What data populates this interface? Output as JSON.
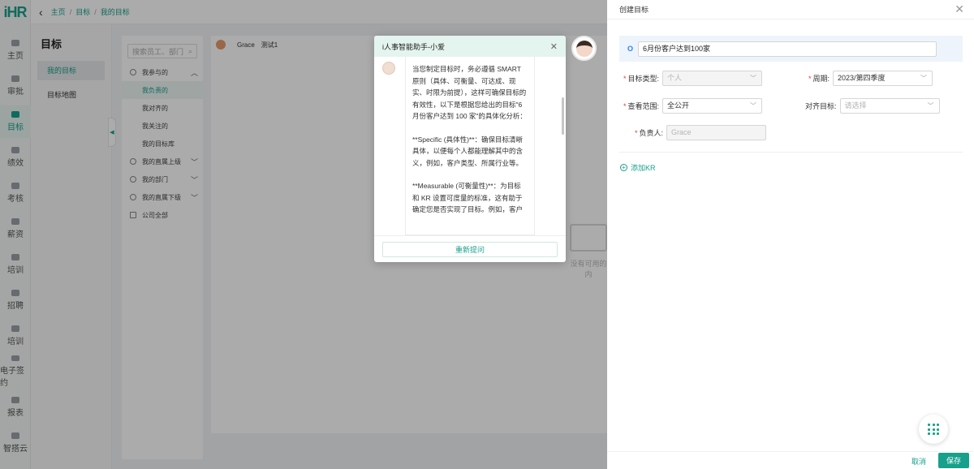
{
  "app": {
    "logo": "iHR"
  },
  "leftnav": [
    {
      "label": "主页",
      "icon": "home-icon"
    },
    {
      "label": "审批",
      "icon": "approve-icon"
    },
    {
      "label": "目标",
      "icon": "target-icon",
      "active": true
    },
    {
      "label": "绩效",
      "icon": "performance-icon"
    },
    {
      "label": "考核",
      "icon": "assessment-icon"
    },
    {
      "label": "薪资",
      "icon": "salary-icon"
    },
    {
      "label": "培训",
      "icon": "training-icon"
    },
    {
      "label": "招聘",
      "icon": "recruit-icon"
    },
    {
      "label": "培训",
      "icon": "training2-icon"
    },
    {
      "label": "电子签约",
      "icon": "esign-icon"
    },
    {
      "label": "报表",
      "icon": "report-icon"
    },
    {
      "label": "智搭云",
      "icon": "cloud-icon"
    }
  ],
  "breadcrumb": {
    "home": "主页",
    "section": "目标",
    "current": "我的目标",
    "separator": "/"
  },
  "submenu": {
    "title": "目标",
    "items": [
      "我的目标",
      "目标地图"
    ]
  },
  "tree": {
    "search_placeholder": "搜索员工、部门",
    "nodes": [
      {
        "label": "我参与的",
        "type": "parent"
      },
      {
        "label": "我负责的",
        "type": "child",
        "active": true
      },
      {
        "label": "我对齐的",
        "type": "child"
      },
      {
        "label": "我关注的",
        "type": "child"
      },
      {
        "label": "我的目标库",
        "type": "child"
      },
      {
        "label": "我的直属上级",
        "type": "parent"
      },
      {
        "label": "我的部门",
        "type": "parent"
      },
      {
        "label": "我的直属下级",
        "type": "parent"
      },
      {
        "label": "公司全部",
        "type": "parent"
      }
    ]
  },
  "main": {
    "user_name": "Grace",
    "user_dept": "测试1",
    "empty_text": "没有可用的内"
  },
  "chat": {
    "title": "i人事智能助手-小爱",
    "paragraphs": [
      "当您制定目标时，务必遵循 SMART 原则（具体、可衡量、可达成、现实、时限为前提），这样可确保目标的有效性，以下是根据您给出的目标\"6 月份客户达到 100 家\"的具体化分析：",
      "**Specific (具体性)**：确保目标清晰具体，以便每个人都能理解其中的含义，例如，客户类型、所属行业等。",
      "**Measurable (可衡量性)**：为目标和 KR 设置可度量的标准，这有助于确定您是否实现了目标。例如，客户"
    ],
    "reask_label": "重新提问"
  },
  "drawer": {
    "title": "创建目标",
    "objective_marker": "O",
    "objective_value": "6月份客户达到100家",
    "fields": {
      "type_label": "目标类型:",
      "type_value": "个人",
      "period_label": "周期:",
      "period_value": "2023/第四季度",
      "scope_label": "查看范围:",
      "scope_value": "全公开",
      "align_label": "对齐目标:",
      "align_placeholder": "请选择",
      "owner_label": "负责人:",
      "owner_value": "Grace"
    },
    "add_kr": "添加KR",
    "cancel": "取消",
    "save": "保存"
  },
  "colors": {
    "accent": "#17a08b",
    "objective_marker": "#2d7df6",
    "required": "#e23c3c"
  }
}
